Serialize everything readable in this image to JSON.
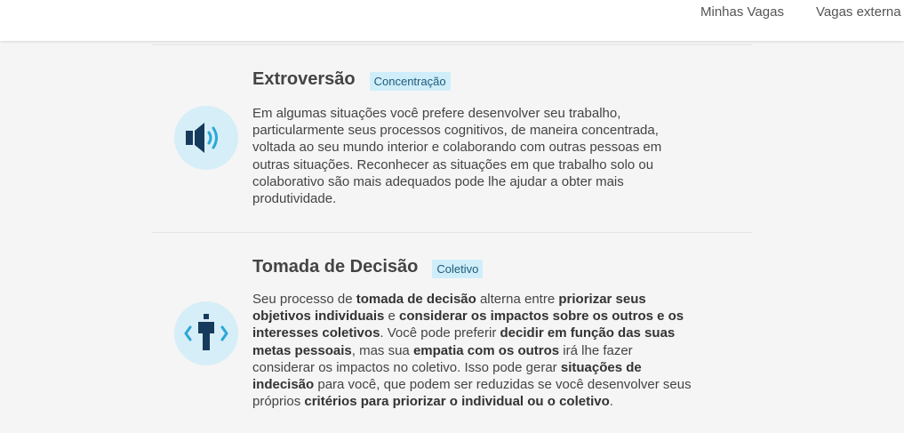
{
  "header": {
    "nav": [
      "Minhas Vagas",
      "Vagas externa"
    ]
  },
  "sections": [
    {
      "title": "Extroversão",
      "badge": "Concentração",
      "icon": "speaker-icon",
      "parts": [
        {
          "t": "Em algumas situações você prefere desenvolver seu trabalho, particularmente seus processos cognitivos, de maneira concentrada, voltada ao seu mundo interior e colaborando com outras pessoas em outras situações. Reconhecer as situações em que trabalho solo ou colaborativo são mais adequados pode lhe ajudar a obter mais produtividade."
        }
      ]
    },
    {
      "title": "Tomada de Decisão",
      "badge": "Coletivo",
      "icon": "person-arrows-icon",
      "parts": [
        {
          "t": "Seu processo de "
        },
        {
          "t": "tomada de decisão",
          "b": true
        },
        {
          "t": " alterna entre "
        },
        {
          "t": "priorizar seus objetivos individuais",
          "b": true
        },
        {
          "t": " e "
        },
        {
          "t": "considerar os impactos sobre os outros e os interesses coletivos",
          "b": true
        },
        {
          "t": ". Você pode preferir "
        },
        {
          "t": "decidir em função das suas metas pessoais",
          "b": true
        },
        {
          "t": ", mas sua "
        },
        {
          "t": "empatia com os outros",
          "b": true
        },
        {
          "t": " irá lhe fazer considerar os impactos no coletivo. Isso pode gerar "
        },
        {
          "t": "situações de indecisão",
          "b": true
        },
        {
          "t": " para você, que podem ser reduzidas se você desenvolver seus próprios "
        },
        {
          "t": "critérios para priorizar o individual ou o coletivo",
          "b": true
        },
        {
          "t": "."
        }
      ]
    }
  ],
  "colors": {
    "icon_bg": "#d6eef7",
    "icon_dark": "#163a5c",
    "icon_accent": "#2ba7d8",
    "badge_bg": "#cfeefa"
  }
}
